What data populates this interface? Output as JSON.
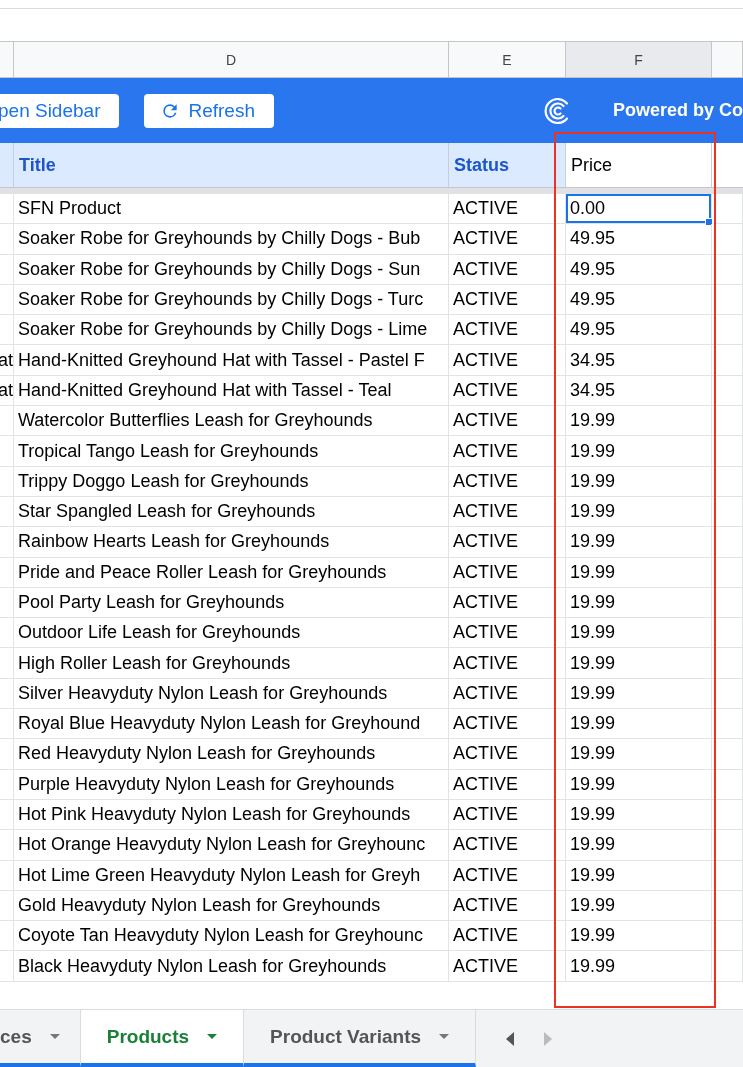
{
  "column_headers": [
    {
      "letter": "D",
      "selected": false
    },
    {
      "letter": "E",
      "selected": false
    },
    {
      "letter": "F",
      "selected": true
    }
  ],
  "toolbar": {
    "buttons": [
      {
        "kind": "sidebar",
        "label": "pen Sidebar"
      },
      {
        "kind": "refresh",
        "label": "Refresh"
      }
    ],
    "brand": "Powered by Co"
  },
  "table": {
    "columns": [
      {
        "label": "Title",
        "kind": "field"
      },
      {
        "label": "Status",
        "kind": "field"
      },
      {
        "label": "Price",
        "kind": "plain"
      }
    ],
    "rows": [
      {
        "c": "",
        "title": "SFN Product",
        "status": "ACTIVE",
        "price": "0.00",
        "selected": true
      },
      {
        "c": "",
        "title": "Soaker Robe for Greyhounds by Chilly Dogs - Bub",
        "status": "ACTIVE",
        "price": "49.95",
        "selected": false
      },
      {
        "c": "",
        "title": "Soaker Robe for Greyhounds by Chilly Dogs - Sun",
        "status": "ACTIVE",
        "price": "49.95",
        "selected": false
      },
      {
        "c": "",
        "title": "Soaker Robe for Greyhounds by Chilly Dogs - Turc",
        "status": "ACTIVE",
        "price": "49.95",
        "selected": false
      },
      {
        "c": "",
        "title": "Soaker Robe for Greyhounds by Chilly Dogs - Lime",
        "status": "ACTIVE",
        "price": "49.95",
        "selected": false
      },
      {
        "c": "at",
        "title": "Hand-Knitted Greyhound Hat with Tassel - Pastel F",
        "status": "ACTIVE",
        "price": "34.95",
        "selected": false
      },
      {
        "c": "at",
        "title": "Hand-Knitted Greyhound Hat with Tassel - Teal",
        "status": "ACTIVE",
        "price": "34.95",
        "selected": false
      },
      {
        "c": "",
        "title": "Watercolor Butterflies Leash for Greyhounds",
        "status": "ACTIVE",
        "price": "19.99",
        "selected": false
      },
      {
        "c": "",
        "title": "Tropical Tango Leash for Greyhounds",
        "status": "ACTIVE",
        "price": "19.99",
        "selected": false
      },
      {
        "c": "",
        "title": "Trippy Doggo Leash for Greyhounds",
        "status": "ACTIVE",
        "price": "19.99",
        "selected": false
      },
      {
        "c": "",
        "title": "Star Spangled Leash for Greyhounds",
        "status": "ACTIVE",
        "price": "19.99",
        "selected": false
      },
      {
        "c": "",
        "title": "Rainbow Hearts Leash for Greyhounds",
        "status": "ACTIVE",
        "price": "19.99",
        "selected": false
      },
      {
        "c": "",
        "title": "Pride and Peace Roller Leash for Greyhounds",
        "status": "ACTIVE",
        "price": "19.99",
        "selected": false
      },
      {
        "c": "",
        "title": "Pool Party Leash for Greyhounds",
        "status": "ACTIVE",
        "price": "19.99",
        "selected": false
      },
      {
        "c": "",
        "title": "Outdoor Life Leash for Greyhounds",
        "status": "ACTIVE",
        "price": "19.99",
        "selected": false
      },
      {
        "c": "",
        "title": "High Roller Leash for Greyhounds",
        "status": "ACTIVE",
        "price": "19.99",
        "selected": false
      },
      {
        "c": "",
        "title": "Silver Heavyduty Nylon Leash for Greyhounds",
        "status": "ACTIVE",
        "price": "19.99",
        "selected": false
      },
      {
        "c": "",
        "title": "Royal Blue Heavyduty Nylon Leash for Greyhound",
        "status": "ACTIVE",
        "price": "19.99",
        "selected": false
      },
      {
        "c": "",
        "title": "Red Heavyduty Nylon Leash for Greyhounds",
        "status": "ACTIVE",
        "price": "19.99",
        "selected": false
      },
      {
        "c": "",
        "title": "Purple Heavyduty Nylon Leash for Greyhounds",
        "status": "ACTIVE",
        "price": "19.99",
        "selected": false
      },
      {
        "c": "",
        "title": "Hot Pink Heavyduty Nylon Leash for Greyhounds",
        "status": "ACTIVE",
        "price": "19.99",
        "selected": false
      },
      {
        "c": "",
        "title": "Hot Orange Heavyduty Nylon Leash for Greyhounc",
        "status": "ACTIVE",
        "price": "19.99",
        "selected": false
      },
      {
        "c": "",
        "title": "Hot Lime Green Heavyduty Nylon Leash for Greyh",
        "status": "ACTIVE",
        "price": "19.99",
        "selected": false
      },
      {
        "c": "",
        "title": "Gold Heavyduty Nylon Leash for Greyhounds",
        "status": "ACTIVE",
        "price": "19.99",
        "selected": false
      },
      {
        "c": "",
        "title": "Coyote Tan Heavyduty Nylon Leash for Greyhounc",
        "status": "ACTIVE",
        "price": "19.99",
        "selected": false
      },
      {
        "c": "",
        "title": "Black Heavyduty Nylon Leash for Greyhounds",
        "status": "ACTIVE",
        "price": "19.99",
        "selected": false
      }
    ]
  },
  "sheet_tabs": [
    {
      "label": "ces",
      "selected": false
    },
    {
      "label": "Products",
      "selected": true
    },
    {
      "label": "Product Variants",
      "selected": false
    }
  ],
  "tab_nav": [
    {
      "kind": "prev",
      "disabled": false
    },
    {
      "kind": "next",
      "disabled": true
    }
  ]
}
